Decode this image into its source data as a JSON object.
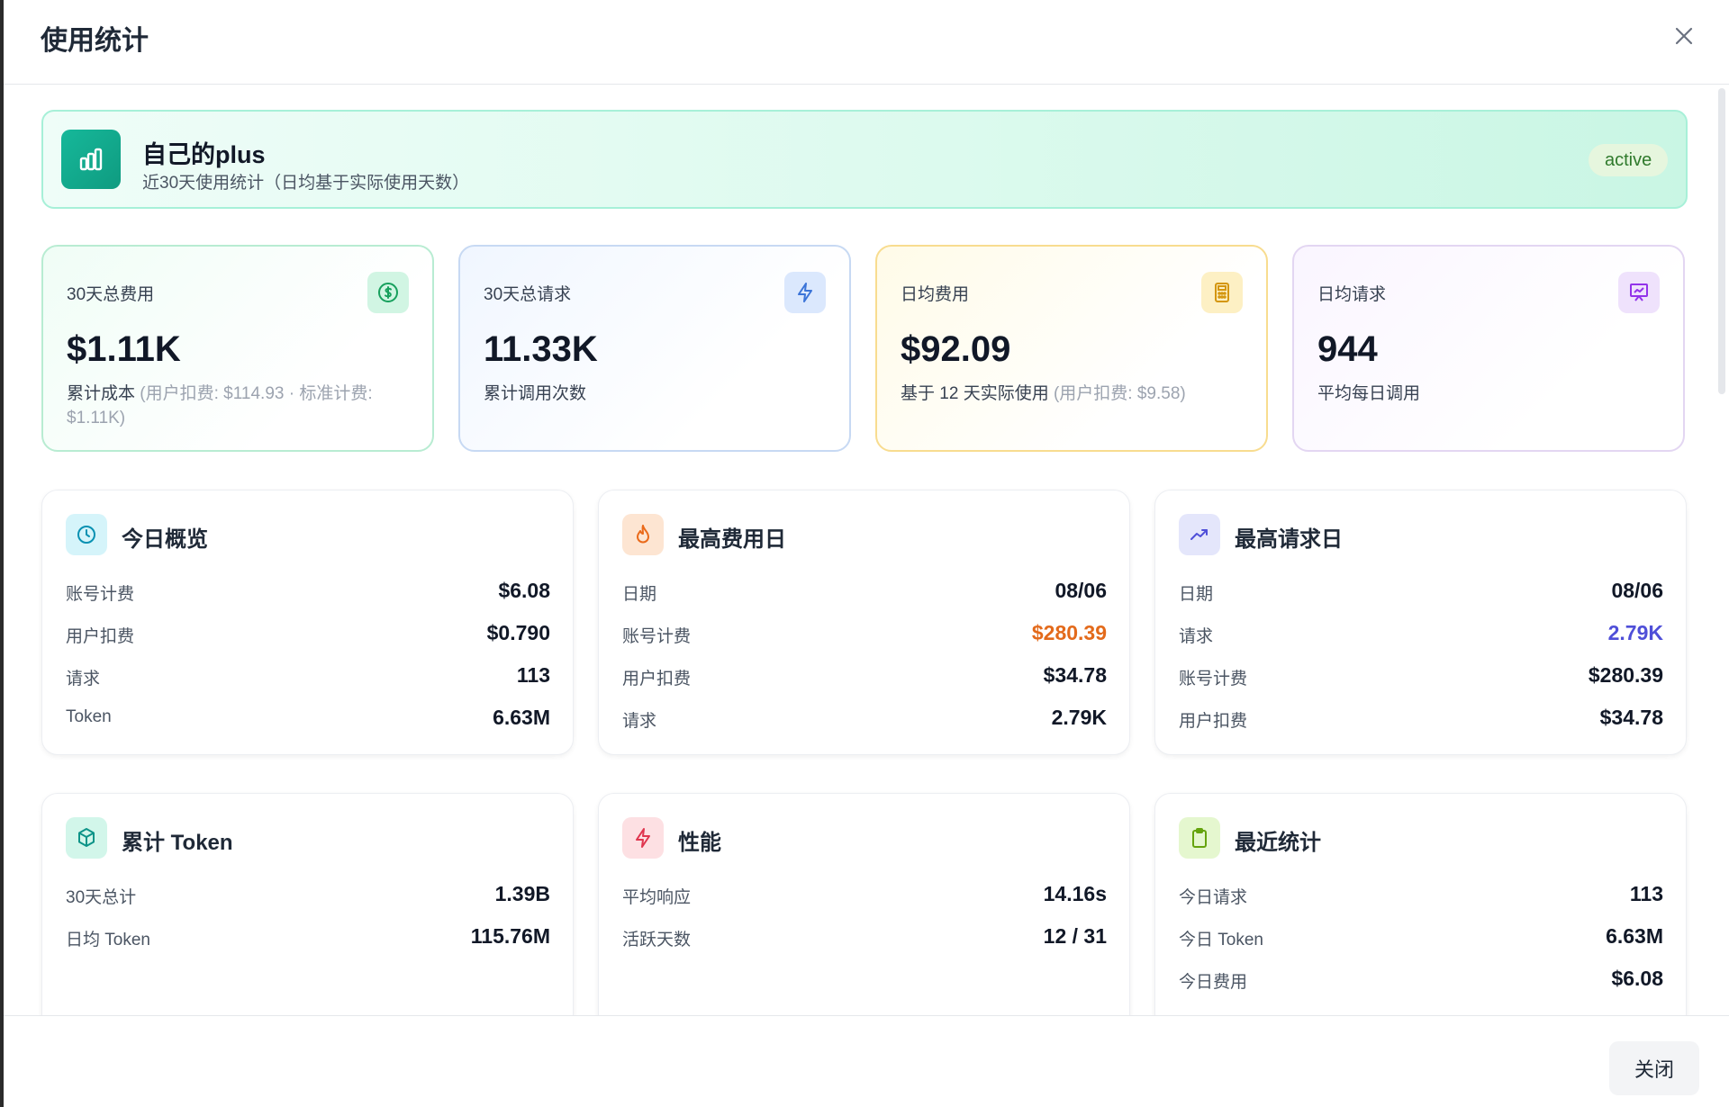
{
  "dialog": {
    "title": "使用统计",
    "close_label": "关闭"
  },
  "banner": {
    "name": "自己的plus",
    "subtitle": "近30天使用统计（日均基于实际使用天数）",
    "status": "active"
  },
  "stats": [
    {
      "label": "30天总费用",
      "value": "$1.11K",
      "desc": "累计成本",
      "desc_muted": "(用户扣费: $114.93 · 标准计费: $1.11K)",
      "icon": "dollar-icon"
    },
    {
      "label": "30天总请求",
      "value": "11.33K",
      "desc": "累计调用次数",
      "desc_muted": "",
      "icon": "bolt-icon"
    },
    {
      "label": "日均费用",
      "value": "$92.09",
      "desc": "基于 12 天实际使用",
      "desc_muted": "(用户扣费: $9.58)",
      "icon": "calculator-icon"
    },
    {
      "label": "日均请求",
      "value": "944",
      "desc": "平均每日调用",
      "desc_muted": "",
      "icon": "presentation-chart-icon"
    }
  ],
  "cards": [
    {
      "title": "今日概览",
      "icon": "clock-icon",
      "rows": [
        {
          "k": "账号计费",
          "v": "$6.08"
        },
        {
          "k": "用户扣费",
          "v": "$0.790"
        },
        {
          "k": "请求",
          "v": "113"
        },
        {
          "k": "Token",
          "v": "6.63M"
        }
      ]
    },
    {
      "title": "最高费用日",
      "icon": "flame-icon",
      "rows": [
        {
          "k": "日期",
          "v": "08/06"
        },
        {
          "k": "账号计费",
          "v": "$280.39"
        },
        {
          "k": "用户扣费",
          "v": "$34.78"
        },
        {
          "k": "请求",
          "v": "2.79K"
        }
      ]
    },
    {
      "title": "最高请求日",
      "icon": "trending-up-icon",
      "rows": [
        {
          "k": "日期",
          "v": "08/06"
        },
        {
          "k": "请求",
          "v": "2.79K"
        },
        {
          "k": "账号计费",
          "v": "$280.39"
        },
        {
          "k": "用户扣费",
          "v": "$34.78"
        }
      ]
    },
    {
      "title": "累计 Token",
      "icon": "cube-icon",
      "rows": [
        {
          "k": "30天总计",
          "v": "1.39B"
        },
        {
          "k": "日均 Token",
          "v": "115.76M"
        }
      ]
    },
    {
      "title": "性能",
      "icon": "bolt-icon",
      "rows": [
        {
          "k": "平均响应",
          "v": "14.16s"
        },
        {
          "k": "活跃天数",
          "v": "12 / 31"
        }
      ]
    },
    {
      "title": "最近统计",
      "icon": "clipboard-icon",
      "rows": [
        {
          "k": "今日请求",
          "v": "113"
        },
        {
          "k": "今日 Token",
          "v": "6.63M"
        },
        {
          "k": "今日费用",
          "v": "$6.08"
        }
      ]
    }
  ],
  "colors": {
    "accent_green": "#16b89a",
    "highlight_orange": "#e36a1b",
    "highlight_blue": "#4f4fd8",
    "status_badge": "#2f7a2c"
  }
}
